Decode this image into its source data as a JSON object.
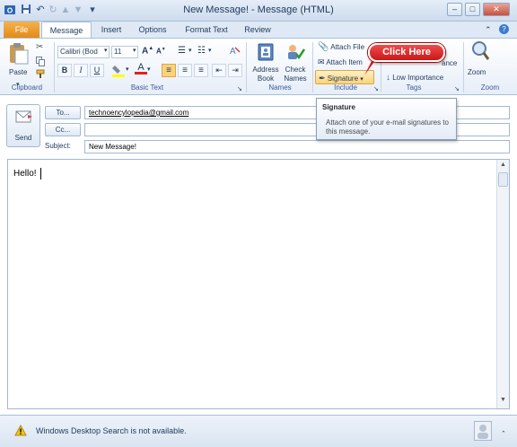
{
  "window": {
    "title": "New Message!  -  Message (HTML)"
  },
  "tabs": [
    {
      "label": "File"
    },
    {
      "label": "Message"
    },
    {
      "label": "Insert"
    },
    {
      "label": "Options"
    },
    {
      "label": "Format Text"
    },
    {
      "label": "Review"
    }
  ],
  "ribbon": {
    "clipboard": {
      "paste_label": "Paste",
      "group_label": "Clipboard"
    },
    "basic_text": {
      "font_name": "Calibri (Bod",
      "font_size": "11",
      "bold": "B",
      "italic": "I",
      "underline": "U",
      "group_label": "Basic Text"
    },
    "names": {
      "address_book_label": "Address Book",
      "check_names_label": "Check Names",
      "group_label": "Names"
    },
    "include": {
      "attach_file_label": "Attach File",
      "attach_item_label": "Attach Item",
      "signature_label": "Signature",
      "group_label": "Include"
    },
    "tags": {
      "high_importance_label": "ance",
      "low_importance_label": "Low Importance",
      "group_label": "Tags"
    },
    "zoom": {
      "zoom_label": "Zoom",
      "group_label": "Zoom"
    }
  },
  "callout": {
    "text": "Click Here"
  },
  "tooltip": {
    "title": "Signature",
    "description": "Attach one of your e-mail signatures to this message."
  },
  "compose": {
    "send_label": "Send",
    "to_label": "To...",
    "cc_label": "Cc...",
    "subject_label": "Subject:",
    "to_value": "technoencylopedia@gmail.com",
    "cc_value": "",
    "subject_value": "New Message!",
    "body_text": "Hello!"
  },
  "status": {
    "message": "Windows Desktop Search is not available."
  },
  "colors": {
    "file_tab": "#e38a19",
    "callout": "#d42020",
    "ribbon_bg": "#e7eef8"
  }
}
